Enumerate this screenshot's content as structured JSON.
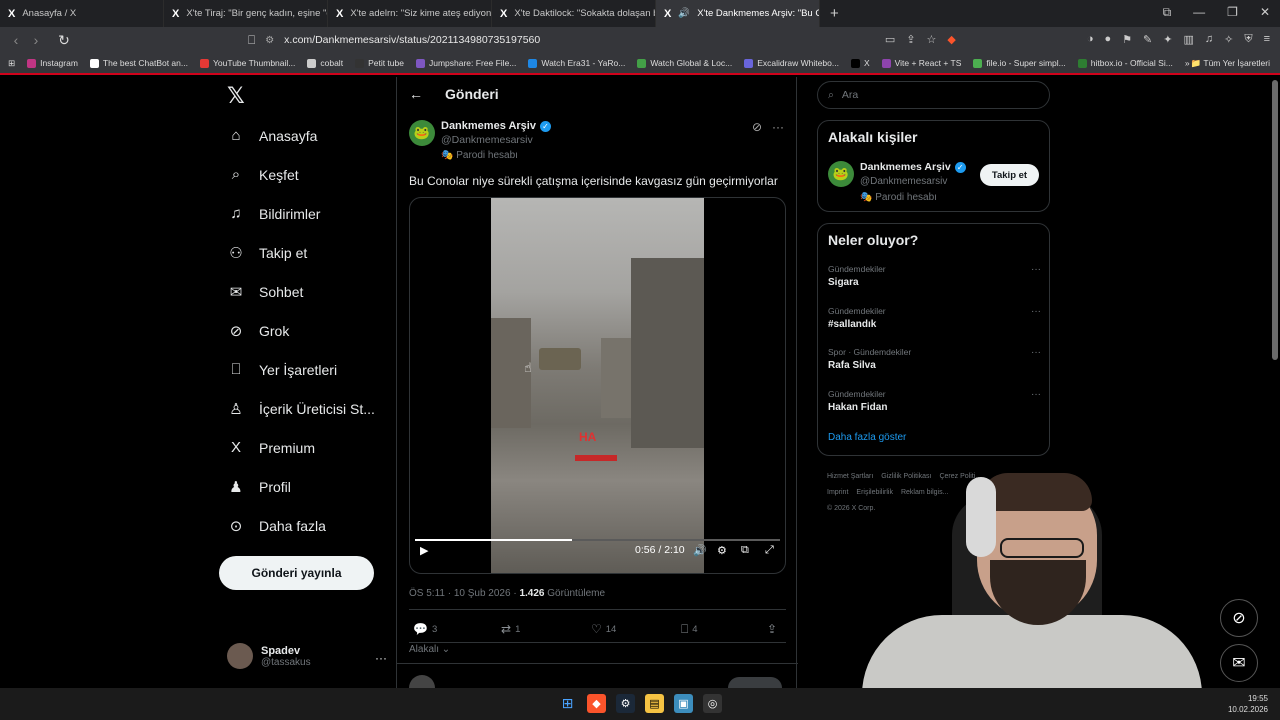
{
  "browser": {
    "tabs": [
      {
        "label": "Anasayfa / X",
        "active": false
      },
      {
        "label": "X'te Tiraj: \"Bir genç kadın, eşine \"gel ...",
        "active": false
      },
      {
        "label": "X'te adelrn: \"Siz kime ateş ediyonuz...",
        "active": false
      },
      {
        "label": "X'te Daktilock: \"Sokakta dolaşan bir l...",
        "active": false
      },
      {
        "label": "X'te Dankmemes Arşiv: \"Bu C...",
        "active": true
      }
    ],
    "new_tab": "+",
    "url": "x.com/Dankmemesarsiv/status/2021134980735197560",
    "bookmarks": [
      {
        "label": "Instagram",
        "color": "#c13584"
      },
      {
        "label": "The best ChatBot an...",
        "color": "#ffffff"
      },
      {
        "label": "YouTube Thumbnail...",
        "color": "#e53935"
      },
      {
        "label": "cobalt",
        "color": "#cccccc"
      },
      {
        "label": "Petit tube",
        "color": "#333333"
      },
      {
        "label": "Jumpshare: Free File...",
        "color": "#7e57c2"
      },
      {
        "label": "Watch Era31 - YaRo...",
        "color": "#1e88e5"
      },
      {
        "label": "Watch Global & Loc...",
        "color": "#43a047"
      },
      {
        "label": "Excalidraw Whitebo...",
        "color": "#6965db"
      },
      {
        "label": "X",
        "color": "#000000"
      },
      {
        "label": "Vite + React + TS",
        "color": "#8e44ad"
      },
      {
        "label": "file.io - Super simpl...",
        "color": "#4caf50"
      },
      {
        "label": "hitbox.io - Official Si...",
        "color": "#2e7d32"
      }
    ],
    "bookmarks_more": "»",
    "all_bookmarks": "Tüm Yer İşaretleri"
  },
  "nav": {
    "items": [
      {
        "label": "Anasayfa",
        "icon": "home-icon",
        "glyph": "⌂"
      },
      {
        "label": "Keşfet",
        "icon": "search-icon",
        "glyph": "⌕"
      },
      {
        "label": "Bildirimler",
        "icon": "bell-icon",
        "glyph": "♫"
      },
      {
        "label": "Takip et",
        "icon": "follow-icon",
        "glyph": "⚇"
      },
      {
        "label": "Sohbet",
        "icon": "mail-icon",
        "glyph": "✉"
      },
      {
        "label": "Grok",
        "icon": "grok-icon",
        "glyph": "⊘"
      },
      {
        "label": "Yer İşaretleri",
        "icon": "bookmark-icon",
        "glyph": "⎕"
      },
      {
        "label": "İçerik Üreticisi St...",
        "icon": "creator-icon",
        "glyph": "♙"
      },
      {
        "label": "Premium",
        "icon": "premium-icon",
        "glyph": "X"
      },
      {
        "label": "Profil",
        "icon": "profile-icon",
        "glyph": "♟"
      },
      {
        "label": "Daha fazla",
        "icon": "more-icon",
        "glyph": "⊙"
      }
    ],
    "post_button": "Gönderi yayınla",
    "profile": {
      "name": "Spadev",
      "handle": "@tassakus",
      "more": "···"
    }
  },
  "main": {
    "back": "←",
    "title": "Gönderi",
    "tweet": {
      "author_name": "Dankmemes Arşiv",
      "author_handle": "@Dankmemesarsiv",
      "parody_label": "Parodi hesabı",
      "text": "Bu Conolar niye sürekli çatışma içerisinde kavgasız gün geçirmiyorlar",
      "video": {
        "current_time": "0:56",
        "duration": "2:10",
        "progress_fraction": 0.43,
        "watermark": "HA"
      },
      "meta_time": "ÖS 5:11 · 10 Şub 2026 · ",
      "views": "1.426",
      "views_label": "Görüntüleme",
      "replies": "3",
      "reposts": "1",
      "likes": "14",
      "bookmarks": "4",
      "related_label": "Alakalı"
    }
  },
  "right": {
    "search_placeholder": "Ara",
    "related_people": {
      "title": "Alakalı kişiler",
      "name": "Dankmemes Arşiv",
      "handle": "@Dankmemesarsiv",
      "parody_label": "Parodi hesabı",
      "follow_label": "Takip et"
    },
    "trends": {
      "title": "Neler oluyor?",
      "items": [
        {
          "category": "Gündemdekiler",
          "title": "Sigara"
        },
        {
          "category": "Gündemdekiler",
          "title": "#sallandık"
        },
        {
          "category": "Spor · Gündemdekiler",
          "title": "Rafa Silva"
        },
        {
          "category": "Gündemdekiler",
          "title": "Hakan Fidan"
        }
      ],
      "show_more": "Daha fazla göster"
    },
    "footer": {
      "links_row1": [
        "Hizmet Şartları",
        "Gizlilik Politikası",
        "Çerez Politi..."
      ],
      "links_row2": [
        "Imprint",
        "Erişilebilirlik",
        "Reklam bilgis..."
      ],
      "copyright": "© 2026 X Corp."
    }
  },
  "taskbar": {
    "time": "19:55",
    "date": "10.02.2026"
  },
  "colors": {
    "accent": "#1d9bf0",
    "brave": "#fb542b"
  }
}
